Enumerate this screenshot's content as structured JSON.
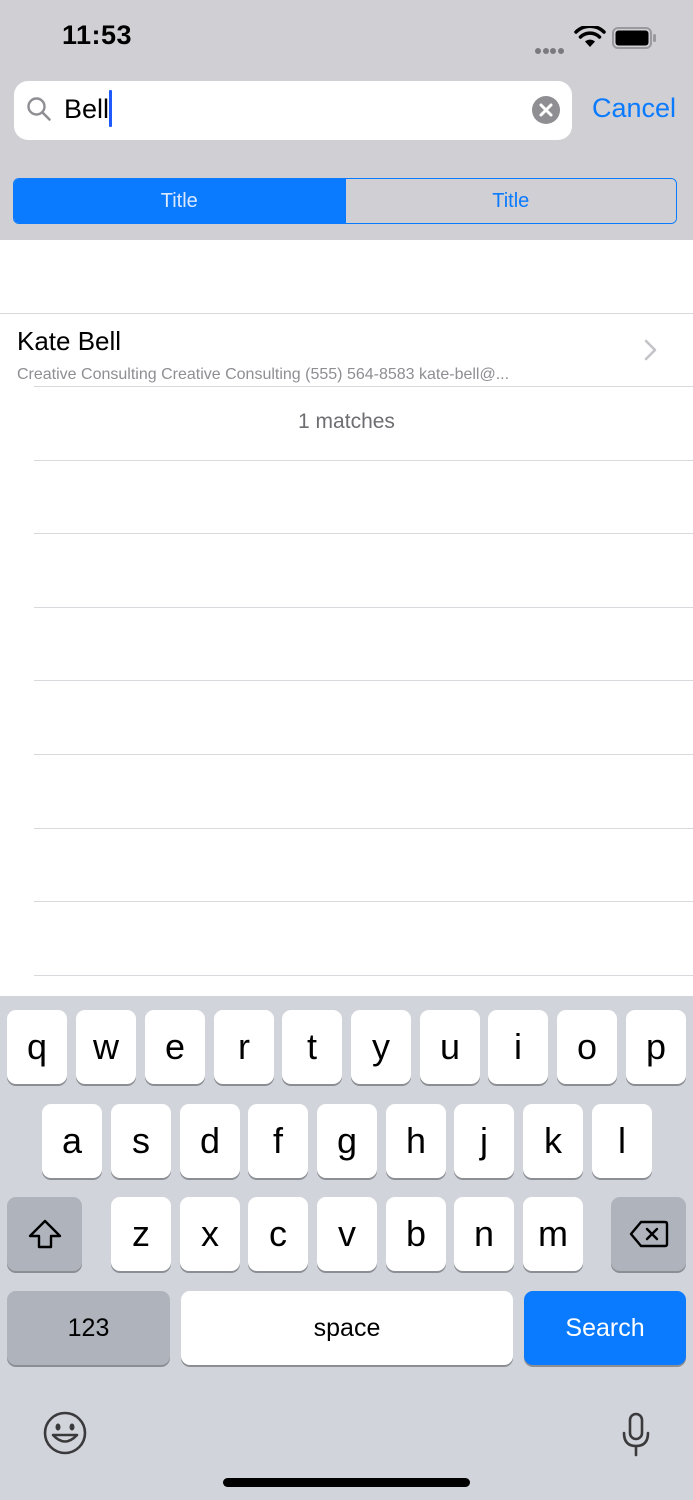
{
  "status_bar": {
    "time": "11:53"
  },
  "search": {
    "query": "Bell",
    "cancel_label": "Cancel"
  },
  "scope": {
    "segments": [
      {
        "label": "Title",
        "selected": true
      },
      {
        "label": "Title",
        "selected": false
      }
    ]
  },
  "results": {
    "items": [
      {
        "name": "Kate Bell",
        "detail": "Creative Consulting Creative Consulting (555) 564-8583 kate-bell@..."
      }
    ],
    "count_label": "1 matches"
  },
  "keyboard": {
    "row1": [
      "q",
      "w",
      "e",
      "r",
      "t",
      "y",
      "u",
      "i",
      "o",
      "p"
    ],
    "row2": [
      "a",
      "s",
      "d",
      "f",
      "g",
      "h",
      "j",
      "k",
      "l"
    ],
    "row3": [
      "z",
      "x",
      "c",
      "v",
      "b",
      "n",
      "m"
    ],
    "numbers_label": "123",
    "space_label": "space",
    "search_label": "Search"
  },
  "colors": {
    "accent": "#0a7aff",
    "header_bg": "#cfcfd4",
    "keyboard_bg": "#d1d4da"
  },
  "icons": [
    "signal-icon",
    "wifi-icon",
    "battery-icon",
    "search-icon",
    "clear-icon",
    "chevron-right-icon",
    "shift-icon",
    "delete-icon",
    "emoji-icon",
    "microphone-icon"
  ]
}
